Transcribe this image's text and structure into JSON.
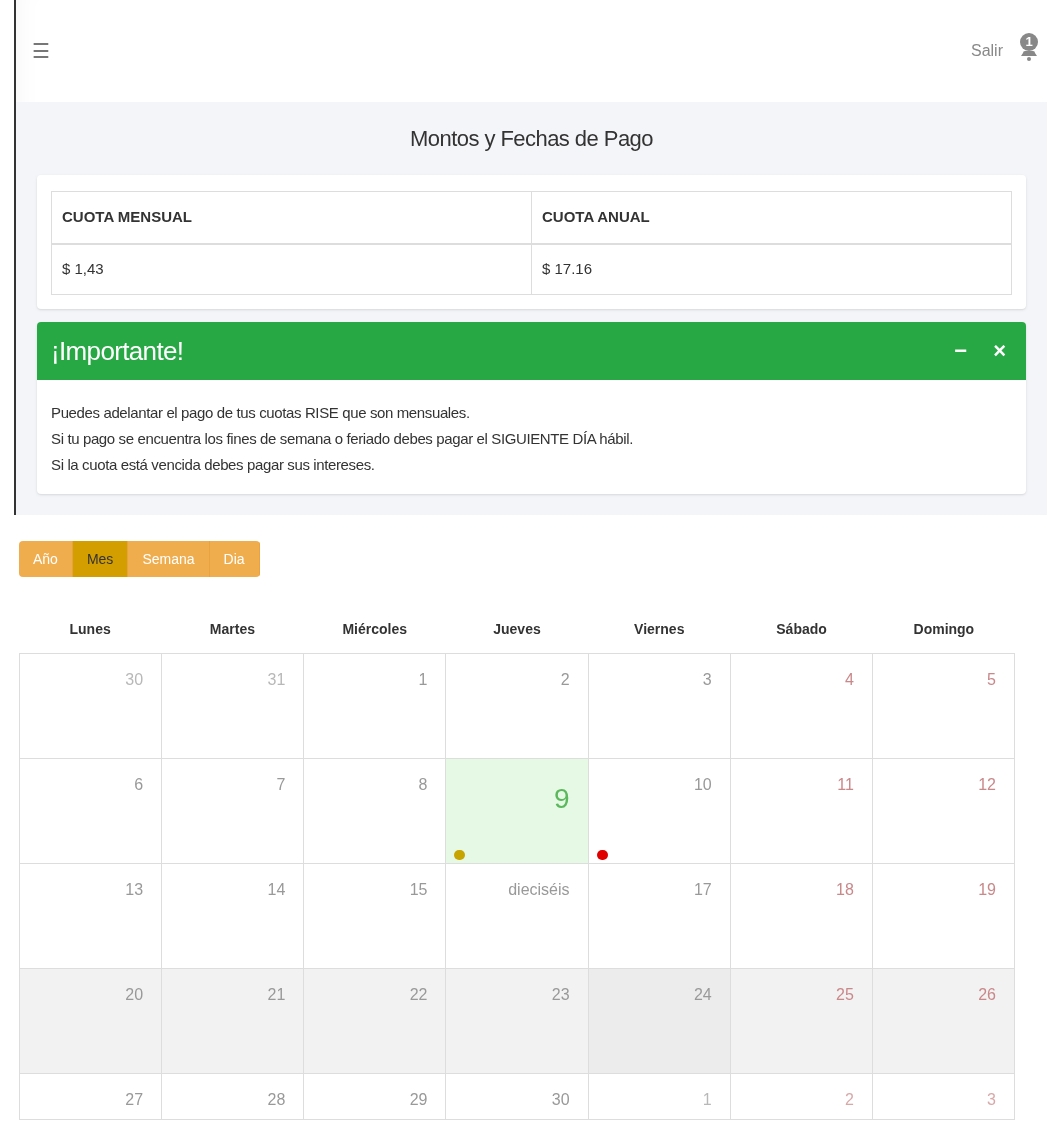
{
  "header": {
    "menu": "☰",
    "logout": "Salir",
    "notifications": "1"
  },
  "title": "Montos y Fechas de Pago",
  "fees_table": {
    "columns": [
      "CUOTA MENSUAL",
      "CUOTA ANUAL"
    ],
    "rows": [
      [
        "$ 1,43",
        "$ 17.16"
      ]
    ]
  },
  "alert": {
    "title": "¡Importante!",
    "minimize": "−",
    "close": "×",
    "lines": [
      "Puedes adelantar el pago de tus cuotas RISE que son mensuales.",
      "Si tu pago se encuentra los fines de semana o feriado debes pagar el SIGUIENTE DÍA hábil.",
      "Si la cuota está vencida debes pagar sus intereses."
    ]
  },
  "view_buttons": [
    {
      "label": "Año",
      "selected": false
    },
    {
      "label": "Mes",
      "selected": true
    },
    {
      "label": "Semana",
      "selected": false
    },
    {
      "label": "Dia",
      "selected": false
    }
  ],
  "weekdays": [
    "Lunes",
    "Martes",
    "Miércoles",
    "Jueves",
    "Viernes",
    "Sábado",
    "Domingo"
  ],
  "weeks": [
    {
      "highlighted": false,
      "days": [
        {
          "label": "30",
          "kind": "other"
        },
        {
          "label": "31",
          "kind": "other"
        },
        {
          "label": "1",
          "kind": "normal"
        },
        {
          "label": "2",
          "kind": "normal"
        },
        {
          "label": "3",
          "kind": "normal"
        },
        {
          "label": "4",
          "kind": "weekend"
        },
        {
          "label": "5",
          "kind": "weekend"
        }
      ]
    },
    {
      "highlighted": false,
      "days": [
        {
          "label": "6",
          "kind": "normal"
        },
        {
          "label": "7",
          "kind": "normal"
        },
        {
          "label": "8",
          "kind": "normal"
        },
        {
          "label": "9",
          "kind": "today",
          "events": [
            {
              "color": "#c8a400"
            }
          ]
        },
        {
          "label": "10",
          "kind": "normal",
          "events": [
            {
              "color": "#e00000"
            }
          ]
        },
        {
          "label": "11",
          "kind": "weekend"
        },
        {
          "label": "12",
          "kind": "weekend"
        }
      ]
    },
    {
      "highlighted": false,
      "days": [
        {
          "label": "13",
          "kind": "normal"
        },
        {
          "label": "14",
          "kind": "normal"
        },
        {
          "label": "15",
          "kind": "normal"
        },
        {
          "label": "dieciséis",
          "kind": "normal"
        },
        {
          "label": "17",
          "kind": "normal"
        },
        {
          "label": "18",
          "kind": "weekend"
        },
        {
          "label": "19",
          "kind": "weekend"
        }
      ]
    },
    {
      "highlighted": true,
      "days": [
        {
          "label": "20",
          "kind": "normal"
        },
        {
          "label": "21",
          "kind": "normal"
        },
        {
          "label": "22",
          "kind": "normal"
        },
        {
          "label": "23",
          "kind": "normal"
        },
        {
          "label": "24",
          "kind": "hovered"
        },
        {
          "label": "25",
          "kind": "weekend"
        },
        {
          "label": "26",
          "kind": "weekend"
        }
      ]
    },
    {
      "highlighted": false,
      "days": [
        {
          "label": "27",
          "kind": "normal"
        },
        {
          "label": "28",
          "kind": "normal"
        },
        {
          "label": "29",
          "kind": "normal"
        },
        {
          "label": "30",
          "kind": "normal"
        },
        {
          "label": "1",
          "kind": "other"
        },
        {
          "label": "2",
          "kind": "other_weekend"
        },
        {
          "label": "3",
          "kind": "other_weekend"
        }
      ]
    }
  ]
}
